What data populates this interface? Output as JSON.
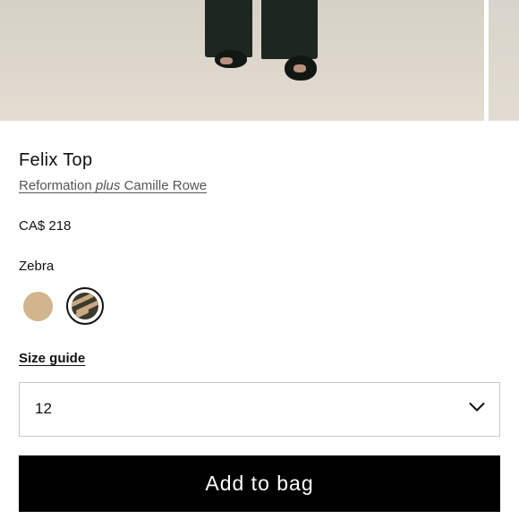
{
  "product": {
    "name": "Felix Top",
    "collab": {
      "brand": "Reformation",
      "connector": "plus",
      "partner": "Camille Rowe"
    },
    "price": "CA$ 218",
    "selected_color": "Zebra",
    "swatches": [
      {
        "name": "tan",
        "color": "#d2b48e",
        "selected": false
      },
      {
        "name": "zebra",
        "color": "#3c3a2c",
        "selected": true
      }
    ]
  },
  "size": {
    "guide_label": "Size guide",
    "selected_value": "12"
  },
  "actions": {
    "add_to_bag_label": "Add to bag"
  },
  "icons": {
    "dropdown": "chevron-down-icon"
  }
}
